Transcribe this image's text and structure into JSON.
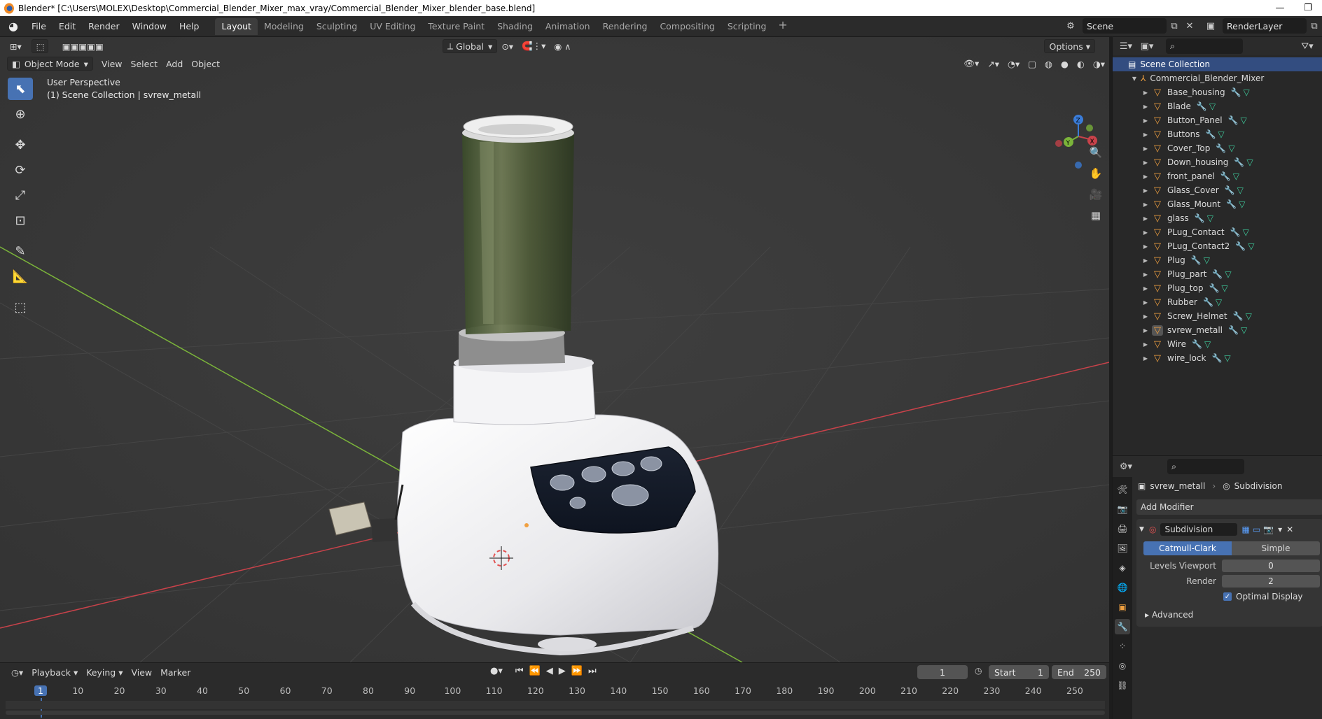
{
  "window": {
    "title": "Blender* [C:\\Users\\MOLEX\\Desktop\\Commercial_Blender_Mixer_max_vray/Commercial_Blender_Mixer_blender_base.blend]",
    "restore_glyph": "❐"
  },
  "menu": [
    "File",
    "Edit",
    "Render",
    "Window",
    "Help"
  ],
  "workspaces": [
    "Layout",
    "Modeling",
    "Sculpting",
    "UV Editing",
    "Texture Paint",
    "Shading",
    "Animation",
    "Rendering",
    "Compositing",
    "Scripting"
  ],
  "active_workspace": "Layout",
  "scene_name": "Scene",
  "view_layer": "RenderLayer",
  "viewport": {
    "mode": "Object Mode",
    "header_menus": [
      "View",
      "Select",
      "Add",
      "Object"
    ],
    "orientation": "Global",
    "options_label": "Options",
    "overlay_line1": "User Perspective",
    "overlay_line2": "(1) Scene Collection | svrew_metall",
    "axis_x": "X",
    "axis_y": "Y",
    "axis_z": "Z"
  },
  "outliner": {
    "root": "Scene Collection",
    "collection": "Commercial_Blender_Mixer",
    "objects": [
      "Base_housing",
      "Blade",
      "Button_Panel",
      "Buttons",
      "Cover_Top",
      "Down_housing",
      "front_panel",
      "Glass_Cover",
      "Glass_Mount",
      "glass",
      "PLug_Contact",
      "PLug_Contact2",
      "Plug",
      "Plug_part",
      "Plug_top",
      "Rubber",
      "Screw_Helmet",
      "svrew_metall",
      "Wire",
      "wire_lock"
    ],
    "selected": "svrew_metall"
  },
  "properties": {
    "object_name": "svrew_metall",
    "modifier_crumb": "Subdivision",
    "add_modifier": "Add Modifier",
    "modifier_name": "Subdivision",
    "method_on": "Catmull-Clark",
    "method_off": "Simple",
    "levels_viewport_label": "Levels Viewport",
    "levels_viewport": "0",
    "render_label": "Render",
    "render_value": "2",
    "optimal_display": "Optimal Display",
    "advanced": "Advanced"
  },
  "timeline": {
    "menus": [
      "Playback",
      "Keying",
      "View",
      "Marker"
    ],
    "current_frame": "1",
    "start_label": "Start",
    "start": "1",
    "end_label": "End",
    "end": "250",
    "ticks": [
      "1",
      "10",
      "20",
      "30",
      "40",
      "50",
      "60",
      "70",
      "80",
      "90",
      "100",
      "110",
      "120",
      "130",
      "140",
      "150",
      "160",
      "170",
      "180",
      "190",
      "200",
      "210",
      "220",
      "230",
      "240",
      "250"
    ]
  },
  "colors": {
    "accent": "#4772b3",
    "viewport_bg": "#393939",
    "panel_bg": "#2b2b2b",
    "mesh_icon": "#f0a040",
    "x_axis": "#c8424a",
    "y_axis": "#7bb43a"
  }
}
